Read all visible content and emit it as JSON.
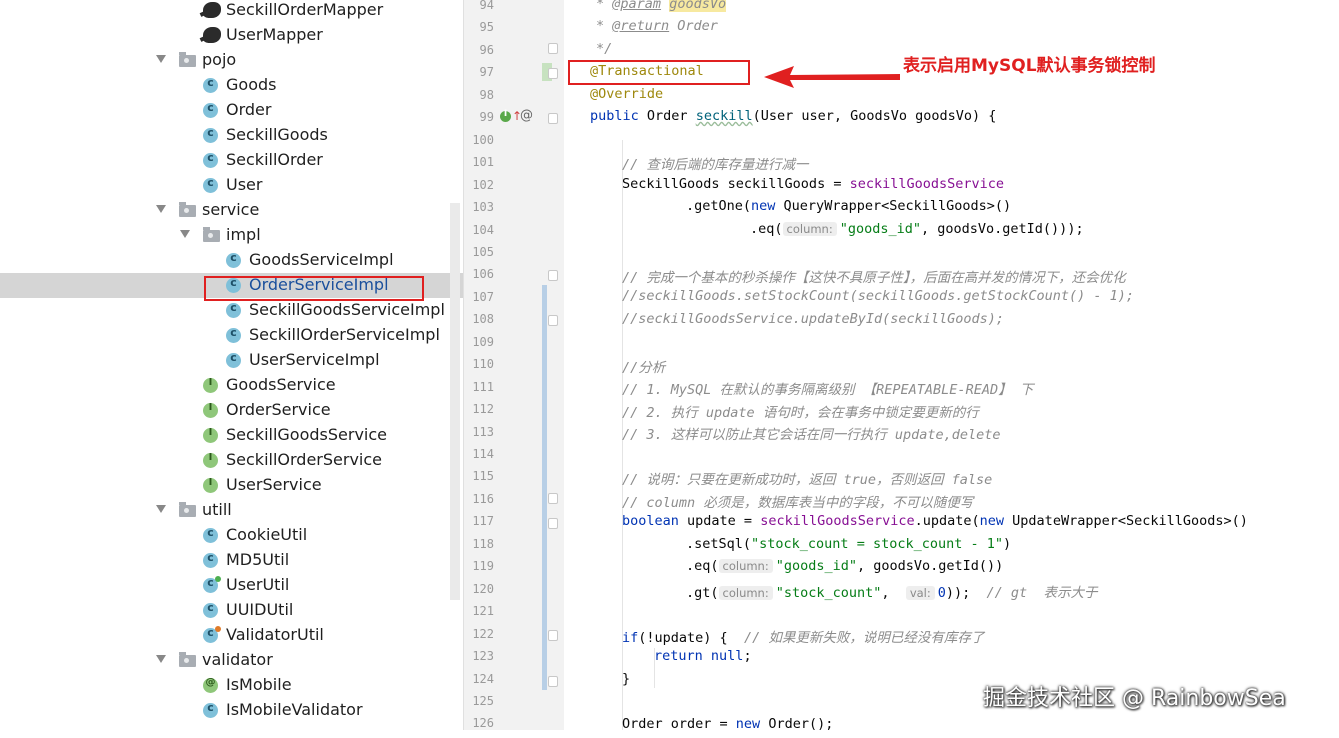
{
  "project_tree": {
    "items": [
      {
        "label": "SeckillOrderMapper",
        "icon": "mybatis-icon"
      },
      {
        "label": "UserMapper",
        "icon": "mybatis-icon"
      },
      {
        "label": "pojo",
        "icon": "folder-icon"
      },
      {
        "label": "Goods",
        "icon": "class-icon"
      },
      {
        "label": "Order",
        "icon": "class-icon"
      },
      {
        "label": "SeckillGoods",
        "icon": "class-icon"
      },
      {
        "label": "SeckillOrder",
        "icon": "class-icon"
      },
      {
        "label": "User",
        "icon": "class-icon"
      },
      {
        "label": "service",
        "icon": "folder-icon"
      },
      {
        "label": "impl",
        "icon": "folder-icon"
      },
      {
        "label": "GoodsServiceImpl",
        "icon": "class-icon"
      },
      {
        "label": "OrderServiceImpl",
        "icon": "class-icon"
      },
      {
        "label": "SeckillGoodsServiceImpl",
        "icon": "class-icon"
      },
      {
        "label": "SeckillOrderServiceImpl",
        "icon": "class-icon"
      },
      {
        "label": "UserServiceImpl",
        "icon": "class-icon"
      },
      {
        "label": "GoodsService",
        "icon": "interface-icon"
      },
      {
        "label": "OrderService",
        "icon": "interface-icon"
      },
      {
        "label": "SeckillGoodsService",
        "icon": "interface-icon"
      },
      {
        "label": "SeckillOrderService",
        "icon": "interface-icon"
      },
      {
        "label": "UserService",
        "icon": "interface-icon"
      },
      {
        "label": "utill",
        "icon": "folder-icon"
      },
      {
        "label": "CookieUtil",
        "icon": "class-icon"
      },
      {
        "label": "MD5Util",
        "icon": "class-icon"
      },
      {
        "label": "UserUtil",
        "icon": "class-icon"
      },
      {
        "label": "UUIDUtil",
        "icon": "class-icon"
      },
      {
        "label": "ValidatorUtil",
        "icon": "class-icon"
      },
      {
        "label": "validator",
        "icon": "folder-icon"
      },
      {
        "label": "IsMobile",
        "icon": "annotation-icon"
      },
      {
        "label": "IsMobileValidator",
        "icon": "class-icon"
      }
    ],
    "selected": "OrderServiceImpl"
  },
  "editor": {
    "line_numbers": [
      "94",
      "95",
      "96",
      "97",
      "98",
      "99",
      "100",
      "101",
      "102",
      "103",
      "104",
      "105",
      "106",
      "107",
      "108",
      "109",
      "110",
      "111",
      "112",
      "113",
      "114",
      "115",
      "116",
      "117",
      "118",
      "119",
      "120",
      "121",
      "122",
      "123",
      "124",
      "125",
      "126"
    ],
    "code": {
      "l94_prefix": "* ",
      "l94_tag": "@param",
      "l94_param": "goodsVo",
      "l95_prefix": "* ",
      "l95_tag": "@return",
      "l95_rest": " Order",
      "l96": "*/",
      "l97": "@Transactional",
      "l98": "@Override",
      "l99_kw": "public",
      "l99_type": " Order ",
      "l99_method": "seckill",
      "l99_rest": "(User user, GoodsVo goodsVo) {",
      "l101": "// 查询后端的库存量进行减一",
      "l102_a": "SeckillGoods seckillGoods = ",
      "l102_b": "seckillGoodsService",
      "l103_a": ".getOne(",
      "l103_kw": "new",
      "l103_b": " QueryWrapper<SeckillGoods>()",
      "l104_a": ".eq(",
      "l104_hint": "column:",
      "l104_str": "\"goods_id\"",
      "l104_b": ", goodsVo.getId()));",
      "l106": "// 完成一个基本的秒杀操作【这快不具原子性】，后面在高并发的情况下，还会优化",
      "l107": "//seckillGoods.setStockCount(seckillGoods.getStockCount() - 1);",
      "l108": "//seckillGoodsService.updateById(seckillGoods);",
      "l110": "//分析",
      "l111": "// 1. MySQL 在默认的事务隔离级别 【REPEATABLE-READ】 下",
      "l112": "// 2. 执行 update 语句时，会在事务中锁定要更新的行",
      "l113": "// 3. 这样可以防止其它会话在同一行执行 update,delete",
      "l115": "// 说明：只要在更新成功时，返回 true，否则返回 false",
      "l116": "// column 必须是，数据库表当中的字段，不可以随便写",
      "l117_kw": "boolean",
      "l117_a": " update = ",
      "l117_fld": "seckillGoodsService",
      "l117_b": ".update(",
      "l117_kw2": "new",
      "l117_c": " UpdateWrapper<SeckillGoods>()",
      "l118_a": ".setSql(",
      "l118_str": "\"stock_count = stock_count - 1\"",
      "l118_b": ")",
      "l119_a": ".eq(",
      "l119_hint": "column:",
      "l119_str": "\"goods_id\"",
      "l119_b": ", goodsVo.getId())",
      "l120_a": ".gt(",
      "l120_hint": "column:",
      "l120_str": "\"stock_count\"",
      "l120_b": ",",
      "l120_hint2": "val:",
      "l120_num": "0",
      "l120_c": "));",
      "l120_cm": "// gt  表示大于",
      "l122_kw": "if",
      "l122_a": "(!update) {  ",
      "l122_cm": "// 如果更新失败，说明已经没有库存了",
      "l123_kw": "return",
      "l123_kw2": "null",
      "l123_b": ";",
      "l124": "}",
      "l126_a": "Order order = ",
      "l126_kw": "new",
      "l126_b": " Order();"
    }
  },
  "annotation": {
    "text": "表示启用MySQL默认事务锁控制",
    "color": "#e02020"
  },
  "watermark": "掘金技术社区 @ RainbowSea"
}
